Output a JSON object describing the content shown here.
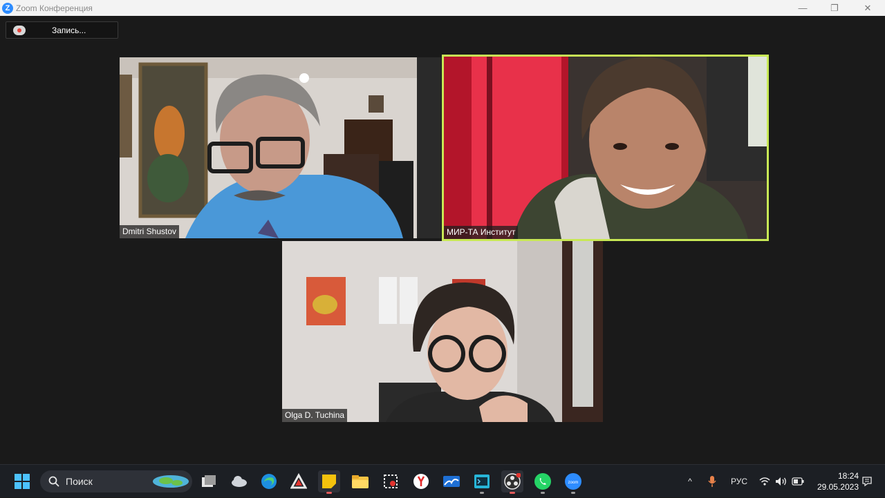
{
  "window": {
    "title": "Zoom Конференция",
    "app_icon": "zoom-icon",
    "min_glyph": "—",
    "max_glyph": "❐",
    "close_glyph": "✕"
  },
  "recording": {
    "label": "Запись...",
    "icon": "cloud-record-icon"
  },
  "participants": [
    {
      "name": "Dmitri Shustov",
      "active_speaker": false
    },
    {
      "name": "МИР-ТА Институт",
      "active_speaker": true
    },
    {
      "name": "Olga D. Tuchina",
      "active_speaker": false
    }
  ],
  "colors": {
    "active_speaker_border": "#c8e855",
    "background": "#1a1a1a",
    "taskbar": "#1c1f24"
  },
  "taskbar": {
    "search_label": "Поиск",
    "apps": [
      {
        "name": "task-view-icon"
      },
      {
        "name": "weather-icon"
      },
      {
        "name": "edge-icon"
      },
      {
        "name": "adobe-icon"
      },
      {
        "name": "sticky-notes-icon",
        "active": true
      },
      {
        "name": "file-explorer-icon"
      },
      {
        "name": "snipping-tool-icon"
      },
      {
        "name": "yandex-browser-icon"
      },
      {
        "name": "mail-icon"
      },
      {
        "name": "terminal-icon"
      },
      {
        "name": "obs-icon",
        "active": true
      },
      {
        "name": "whatsapp-icon"
      },
      {
        "name": "zoom-taskbar-icon"
      }
    ],
    "tray": {
      "chevron": "^",
      "language": "РУС",
      "time": "18:24",
      "date": "29.05.2023"
    }
  }
}
